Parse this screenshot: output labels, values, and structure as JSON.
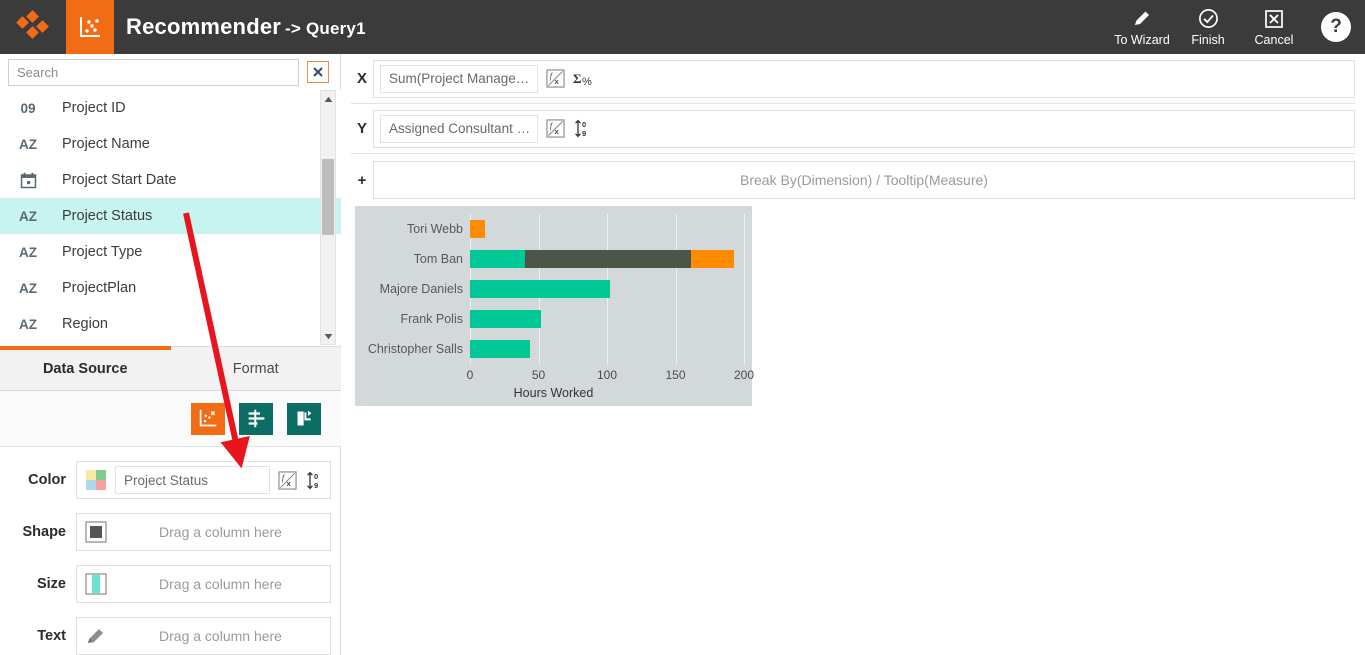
{
  "header": {
    "app_icon": "diamond-logo-icon",
    "chart_icon": "scatter-chart-icon",
    "title": "Recommender",
    "subtitle": "-> Query1",
    "actions": [
      {
        "label": "To Wizard",
        "icon": "pencil-icon"
      },
      {
        "label": "Finish",
        "icon": "check-circle-icon"
      },
      {
        "label": "Cancel",
        "icon": "close-box-icon"
      }
    ],
    "help_label": "?"
  },
  "sidebar": {
    "search": {
      "placeholder": "Search",
      "value": ""
    },
    "clear_icon": "close-box-icon",
    "fields": [
      {
        "type": "09",
        "label": "Project ID",
        "selected": false
      },
      {
        "type": "AZ",
        "label": "Project Name",
        "selected": false
      },
      {
        "type": "date",
        "label": "Project Start Date",
        "selected": false
      },
      {
        "type": "AZ",
        "label": "Project Status",
        "selected": true
      },
      {
        "type": "AZ",
        "label": "Project Type",
        "selected": false
      },
      {
        "type": "AZ",
        "label": "ProjectPlan",
        "selected": false
      },
      {
        "type": "AZ",
        "label": "Region",
        "selected": false
      }
    ],
    "tabs": [
      {
        "label": "Data Source",
        "active": true
      },
      {
        "label": "Format",
        "active": false
      }
    ],
    "tools": [
      {
        "icon": "chart-type-icon",
        "color": "#f26b15"
      },
      {
        "icon": "filter-align-icon",
        "color": "#0b6d63"
      },
      {
        "icon": "reset-undo-icon",
        "color": "#0b6d63"
      }
    ],
    "shelves": [
      {
        "label": "Color",
        "icon": "color-swatch-icon",
        "value": "Project Status",
        "placeholder": "",
        "has_value": true
      },
      {
        "label": "Shape",
        "icon": "shape-square-icon",
        "value": "",
        "placeholder": "Drag a column here",
        "has_value": false
      },
      {
        "label": "Size",
        "icon": "size-bar-icon",
        "value": "",
        "placeholder": "Drag a column here",
        "has_value": false
      },
      {
        "label": "Text",
        "icon": "pencil-icon",
        "value": "",
        "placeholder": "Drag a column here",
        "has_value": false
      }
    ],
    "fx_icon": "function-fx-icon",
    "sort_icon": "sort-numeric-icon"
  },
  "main": {
    "x_shelf": {
      "letter": "X",
      "value": "Sum(Project Manage…",
      "fx_icon": "function-fx-icon",
      "agg_icon": "sigma-percent-icon"
    },
    "y_shelf": {
      "letter": "Y",
      "value": "Assigned Consultant …",
      "fx_icon": "function-fx-icon",
      "sort_icon": "sort-numeric-icon"
    },
    "break_shelf": {
      "letter": "+",
      "placeholder": "Break By(Dimension) / Tooltip(Measure)"
    }
  },
  "chart_data": {
    "type": "bar",
    "orientation": "horizontal",
    "stacked": true,
    "title": "",
    "xlabel": "Hours Worked",
    "ylabel": "",
    "xlim": [
      0,
      200
    ],
    "xticks": [
      0,
      50,
      100,
      150,
      200
    ],
    "grid": true,
    "legend_position": "none",
    "categories": [
      "Tori Webb",
      "Tom Ban",
      "Majore Daniels",
      "Frank Polis",
      "Christopher Salls"
    ],
    "series": [
      {
        "name": "green",
        "color": "#00c896",
        "values": [
          0,
          40,
          102,
          52,
          44
        ]
      },
      {
        "name": "dark",
        "color": "#4d5448",
        "values": [
          0,
          121,
          0,
          0,
          0
        ]
      },
      {
        "name": "orange",
        "color": "#ff8c00",
        "values": [
          11,
          32,
          0,
          0,
          0
        ]
      }
    ],
    "totals": [
      11,
      193,
      102,
      52,
      44
    ]
  },
  "annotation": {
    "color": "#e8141e",
    "from": "project-status-field",
    "to": "color-shelf"
  }
}
